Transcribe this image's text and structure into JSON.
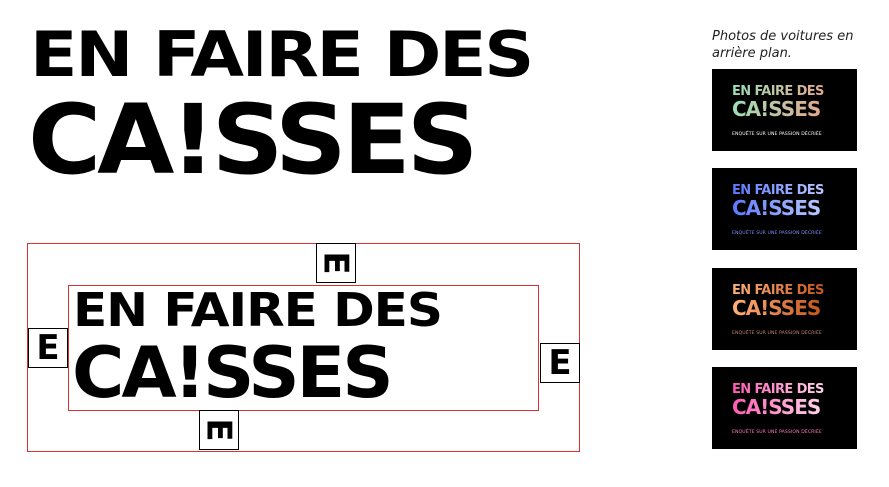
{
  "logo": {
    "line1": "EN FAIRE DES",
    "line2": "CA!SSES"
  },
  "construction": {
    "line1": "EN FAIRE DES",
    "line2": "CA!SSES",
    "unit_letter": "E",
    "guide_color": "#d33333"
  },
  "caption": "Photos de voitures en arrière plan.",
  "thumbnails": [
    {
      "line1": "EN FAIRE DES",
      "line2": "CA!SSES",
      "subtitle": "ENQUÊTE SUR UNE PASSION DÉCRIÉE",
      "gradient": [
        "#9be0b8",
        "#e4a890"
      ],
      "subtitle_color": "#ffffff"
    },
    {
      "line1": "EN FAIRE DES",
      "line2": "CA!SSES",
      "subtitle": "ENQUÊTE SUR UNE PASSION DÉCRIÉE",
      "gradient": [
        "#5b78ff",
        "#b8c8ff"
      ],
      "subtitle_color": "#7f8dff"
    },
    {
      "line1": "EN FAIRE DES",
      "line2": "CA!SSES",
      "subtitle": "ENQUÊTE SUR UNE PASSION DÉCRIÉE",
      "gradient": [
        "#ffb07a",
        "#c4561f"
      ],
      "subtitle_color": "#c48a6a"
    },
    {
      "line1": "EN FAIRE DES",
      "line2": "CA!SSES",
      "subtitle": "ENQUÊTE SUR UNE PASSION DÉCRIÉE",
      "gradient": [
        "#ff5ab4",
        "#ffd2e8"
      ],
      "subtitle_color": "#ff7ec0"
    }
  ]
}
